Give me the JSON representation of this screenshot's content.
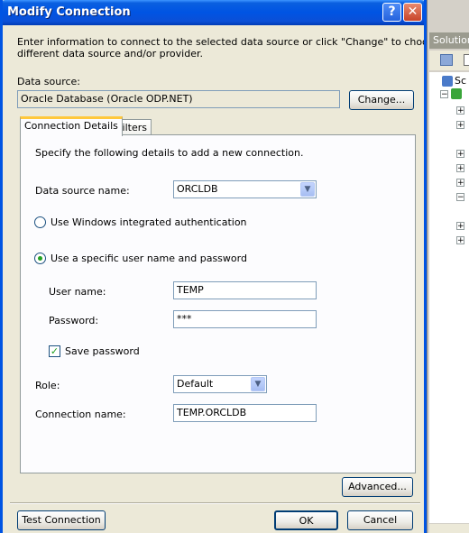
{
  "window": {
    "title": "Modify Connection",
    "help_glyph": "?",
    "close_glyph": "✕"
  },
  "intro_text": [
    "Enter information to connect to the selected data source or click \"Change\" to choose a",
    "different data source and/or provider."
  ],
  "data_source": {
    "label": "Data source:",
    "value": "Oracle Database (Oracle ODP.NET)",
    "change_button": "Change..."
  },
  "tabs": [
    {
      "label": "Connection Details"
    },
    {
      "label": "Filters"
    }
  ],
  "details": {
    "instructions": "Specify the following details to add a new connection.",
    "data_source_name_label": "Data source name:",
    "data_source_name_value": "ORCLDB",
    "windows_auth_label": "Use Windows integrated authentication",
    "specific_user_label": "Use a specific user name and password",
    "user_name_label": "User name:",
    "user_name_value": "TEMP",
    "password_label": "Password:",
    "password_value": "***",
    "save_password_label": "Save password",
    "role_label": "Role:",
    "role_value": "Default",
    "connection_name_label": "Connection name:",
    "connection_name_value": "TEMP.ORCLDB"
  },
  "buttons": {
    "advanced": "Advanced...",
    "test_connection": "Test Connection",
    "ok": "OK",
    "cancel": "Cancel"
  },
  "side_panel": {
    "header": "Solution",
    "first_item": "Sc"
  },
  "colors": {
    "title_bar": "#0054e3",
    "dialog_bg": "#ece9d8",
    "tab_highlight": "#ffc83c",
    "radio_dot": "#21a121"
  }
}
